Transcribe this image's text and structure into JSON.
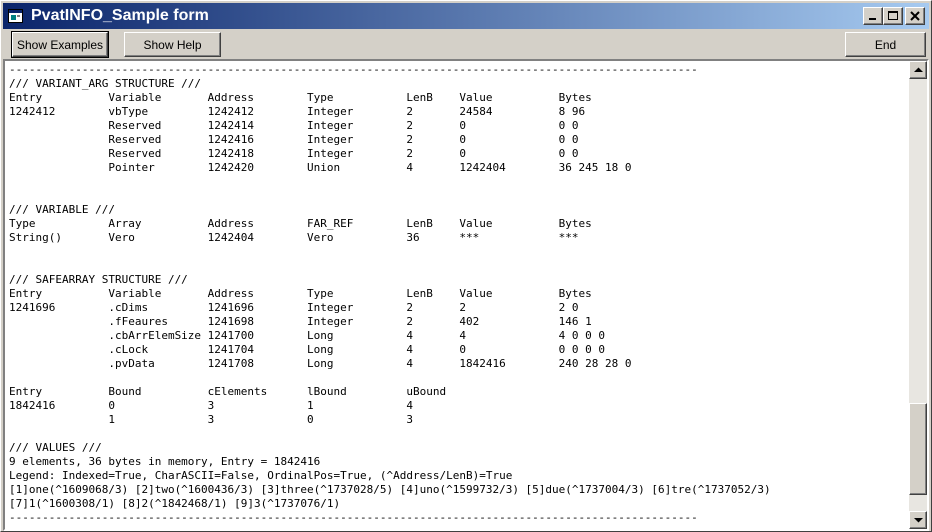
{
  "window": {
    "title": "PvatINFO_Sample form",
    "icon": "vb-form-icon",
    "controls": [
      "minimize-icon",
      "maximize-icon",
      "close-icon"
    ]
  },
  "toolbar": {
    "show_examples_label": "Show Examples",
    "show_help_label": "Show Help",
    "end_label": "End"
  },
  "output": {
    "lines": [
      "--------------------------------------------------------------------------------------------------------",
      "/// VARIANT_ARG STRUCTURE ///",
      "Entry          Variable       Address        Type           LenB    Value          Bytes",
      "1242412        vbType         1242412        Integer        2       24584          8 96",
      "               Reserved       1242414        Integer        2       0              0 0",
      "               Reserved       1242416        Integer        2       0              0 0",
      "               Reserved       1242418        Integer        2       0              0 0",
      "               Pointer        1242420        Union          4       1242404        36 245 18 0",
      "",
      "",
      "/// VARIABLE ///",
      "Type           Array          Address        FAR_REF        LenB    Value          Bytes",
      "String()       Vero           1242404        Vero           36      ***            ***",
      "",
      "",
      "/// SAFEARRAY STRUCTURE ///",
      "Entry          Variable       Address        Type           LenB    Value          Bytes",
      "1241696        .cDims         1241696        Integer        2       2              2 0",
      "               .fFeaures      1241698        Integer        2       402            146 1",
      "               .cbArrElemSize 1241700        Long           4       4              4 0 0 0",
      "               .cLock         1241704        Long           4       0              0 0 0 0",
      "               .pvData        1241708        Long           4       1842416        240 28 28 0",
      "",
      "Entry          Bound          cElements      lBound         uBound",
      "1842416        0              3              1              4",
      "               1              3              0              3",
      "",
      "/// VALUES ///",
      "9 elements, 36 bytes in memory, Entry = 1842416",
      "Legend: Indexed=True, CharASCII=False, OrdinalPos=True, (^Address/LenB)=True",
      "[1]one(^1609068/3) [2]two(^1600436/3) [3]three(^1737028/5) [4]uno(^1599732/3) [5]due(^1737004/3) [6]tre(^1737052/3)",
      "[7]1(^1600308/1) [8]2(^1842468/1) [9]3(^1737076/1)",
      "--------------------------------------------------------------------------------------------------------"
    ]
  },
  "scrollbar": {
    "up_icon": "arrow-up-icon",
    "down_icon": "arrow-down-icon"
  },
  "colors": {
    "titlebar_start": "#0a246a",
    "titlebar_end": "#a6caf0",
    "face": "#d4d0c8"
  }
}
